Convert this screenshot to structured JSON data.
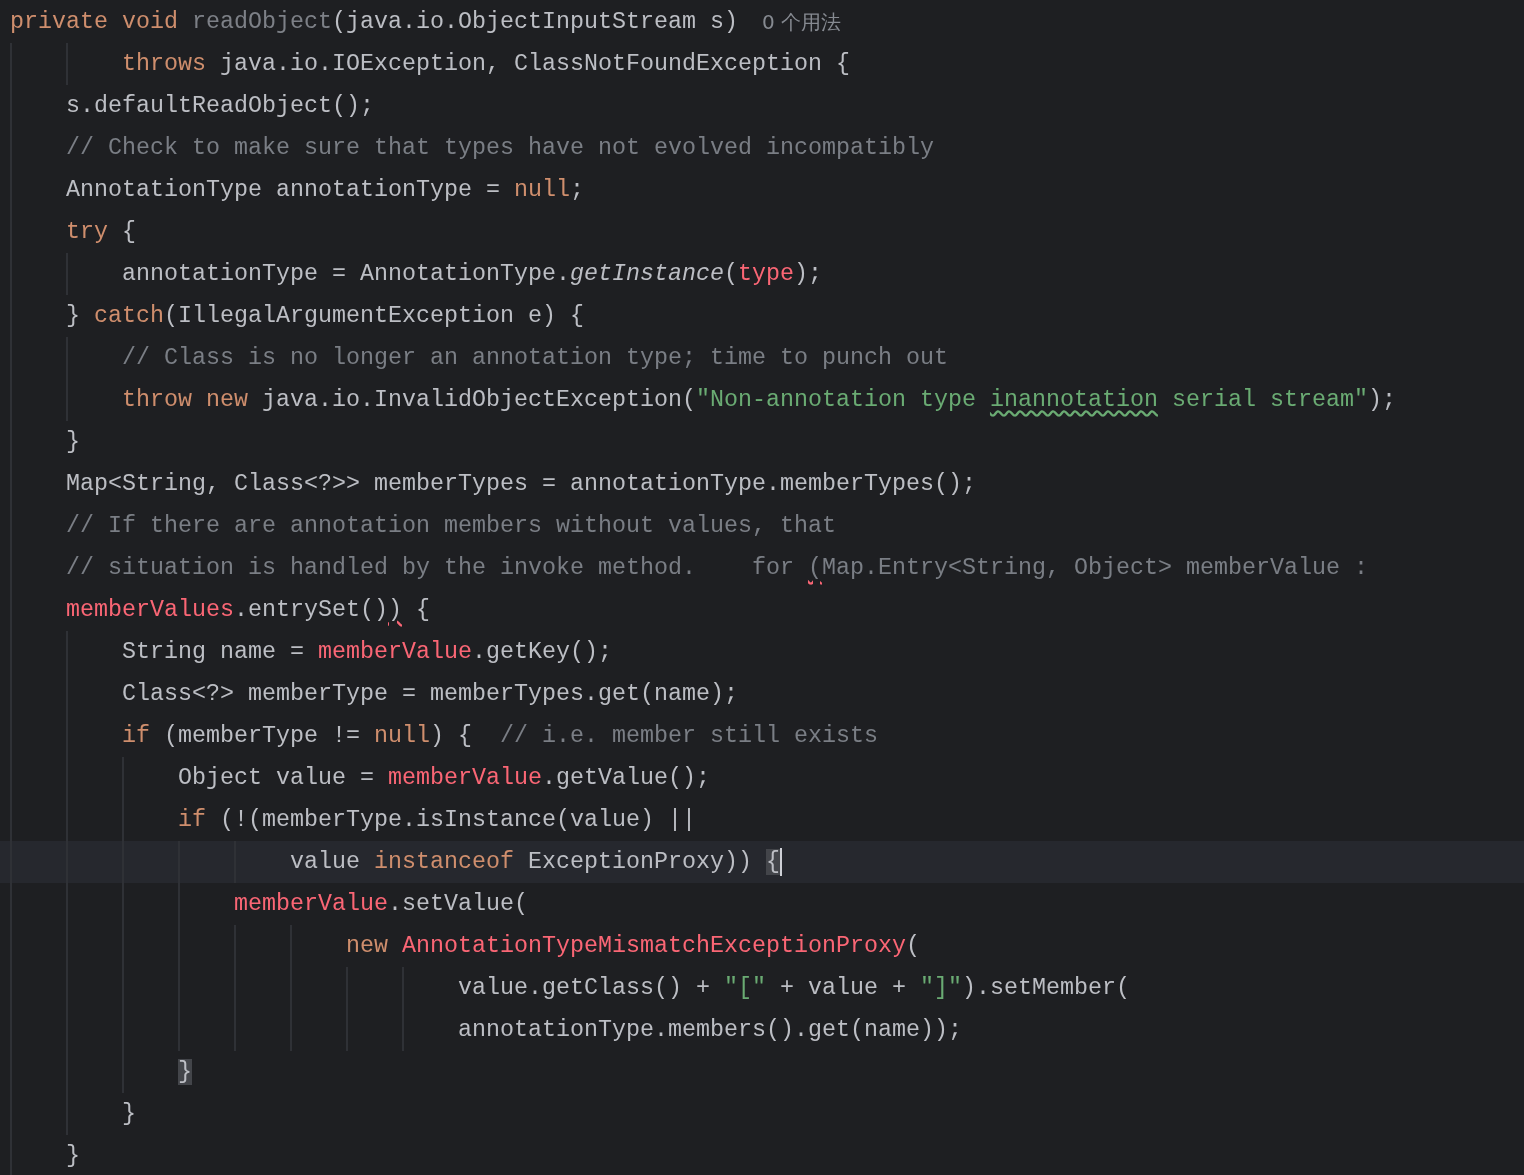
{
  "editor": {
    "lines": [
      {
        "current": false,
        "hint": "0 个用法",
        "tokens": [
          {
            "kind": "keyword",
            "text": "private void "
          },
          {
            "kind": "unused",
            "text": "readObject"
          },
          {
            "kind": "plain",
            "text": "(java.io.ObjectInputStream s)"
          }
        ]
      },
      {
        "current": false,
        "tokens": [
          {
            "kind": "keyword",
            "text": "        throws"
          },
          {
            "kind": "plain",
            "text": " java.io.IOException, ClassNotFoundException {"
          }
        ]
      },
      {
        "current": false,
        "tokens": [
          {
            "kind": "plain",
            "text": "    s.defaultReadObject();"
          }
        ]
      },
      {
        "current": false,
        "tokens": [
          {
            "kind": "comment",
            "text": "    // Check to make sure that types have not evolved incompatibly"
          }
        ]
      },
      {
        "current": false,
        "tokens": [
          {
            "kind": "plain",
            "text": "    AnnotationType annotationType = "
          },
          {
            "kind": "keyword",
            "text": "null"
          },
          {
            "kind": "plain",
            "text": ";"
          }
        ]
      },
      {
        "current": false,
        "tokens": [
          {
            "kind": "keyword",
            "text": "    try"
          },
          {
            "kind": "plain",
            "text": " {"
          }
        ]
      },
      {
        "current": false,
        "tokens": [
          {
            "kind": "plain",
            "text": "        annotationType = AnnotationType."
          },
          {
            "kind": "italic",
            "text": "getInstance"
          },
          {
            "kind": "plain",
            "text": "("
          },
          {
            "kind": "error",
            "text": "type"
          },
          {
            "kind": "plain",
            "text": ");"
          }
        ]
      },
      {
        "current": false,
        "tokens": [
          {
            "kind": "plain",
            "text": "    } "
          },
          {
            "kind": "keyword",
            "text": "catch"
          },
          {
            "kind": "plain",
            "text": "(IllegalArgumentException e) {"
          }
        ]
      },
      {
        "current": false,
        "tokens": [
          {
            "kind": "comment",
            "text": "        // Class is no longer an annotation type; time to punch out"
          }
        ]
      },
      {
        "current": false,
        "tokens": [
          {
            "kind": "keyword",
            "text": "        throw new"
          },
          {
            "kind": "plain",
            "text": " java.io.InvalidObjectException("
          },
          {
            "kind": "string",
            "text": "\"Non-annotation type "
          },
          {
            "kind": "string",
            "text": "inannotation",
            "typo": true
          },
          {
            "kind": "string",
            "text": " serial stream\""
          },
          {
            "kind": "plain",
            "text": ");"
          }
        ]
      },
      {
        "current": false,
        "tokens": [
          {
            "kind": "plain",
            "text": "    }"
          }
        ]
      },
      {
        "current": false,
        "tokens": [
          {
            "kind": "plain",
            "text": "    Map<String, Class<?>> memberTypes = annotationType.memberTypes();"
          }
        ]
      },
      {
        "current": false,
        "tokens": [
          {
            "kind": "comment",
            "text": "    // If there are annotation members without values, that"
          }
        ]
      },
      {
        "current": false,
        "tokens": [
          {
            "kind": "comment",
            "text": "    // situation is handled by the invoke method.    for "
          },
          {
            "kind": "comment",
            "text": "(",
            "flagged": true
          },
          {
            "kind": "comment",
            "text": "Map.Entry<String, Object> memberValue :"
          }
        ]
      },
      {
        "current": false,
        "tokens": [
          {
            "kind": "error",
            "text": "    memberValues"
          },
          {
            "kind": "plain",
            "text": ".entrySet()"
          },
          {
            "kind": "plain",
            "text": ")",
            "flagged": true
          },
          {
            "kind": "plain",
            "text": " {"
          }
        ]
      },
      {
        "current": false,
        "tokens": [
          {
            "kind": "plain",
            "text": "        String name = "
          },
          {
            "kind": "error",
            "text": "memberValue"
          },
          {
            "kind": "plain",
            "text": ".getKey();"
          }
        ]
      },
      {
        "current": false,
        "tokens": [
          {
            "kind": "plain",
            "text": "        Class<?> memberType = memberTypes.get(name);"
          }
        ]
      },
      {
        "current": false,
        "tokens": [
          {
            "kind": "keyword",
            "text": "        if"
          },
          {
            "kind": "plain",
            "text": " (memberType != "
          },
          {
            "kind": "keyword",
            "text": "null"
          },
          {
            "kind": "plain",
            "text": ") {  "
          },
          {
            "kind": "comment",
            "text": "// i.e. member still exists"
          }
        ]
      },
      {
        "current": false,
        "tokens": [
          {
            "kind": "plain",
            "text": "            Object value = "
          },
          {
            "kind": "error",
            "text": "memberValue"
          },
          {
            "kind": "plain",
            "text": ".getValue();"
          }
        ]
      },
      {
        "current": false,
        "tokens": [
          {
            "kind": "keyword",
            "text": "            if"
          },
          {
            "kind": "plain",
            "text": " (!(memberType.isInstance(value) ||"
          }
        ]
      },
      {
        "current": true,
        "tokens": [
          {
            "kind": "plain",
            "text": "                    value "
          },
          {
            "kind": "keyword",
            "text": "instanceof"
          },
          {
            "kind": "plain",
            "text": " ExceptionProxy)) "
          },
          {
            "kind": "plain",
            "text": "{",
            "matched": true
          }
        ]
      },
      {
        "current": false,
        "tokens": [
          {
            "kind": "error",
            "text": "                memberValue"
          },
          {
            "kind": "plain",
            "text": ".setValue("
          }
        ]
      },
      {
        "current": false,
        "tokens": [
          {
            "kind": "keyword",
            "text": "                        new "
          },
          {
            "kind": "error",
            "text": "AnnotationTypeMismatchExceptionProxy"
          },
          {
            "kind": "plain",
            "text": "("
          }
        ]
      },
      {
        "current": false,
        "tokens": [
          {
            "kind": "plain",
            "text": "                                value.getClass() + "
          },
          {
            "kind": "string",
            "text": "\"[\""
          },
          {
            "kind": "plain",
            "text": " + value + "
          },
          {
            "kind": "string",
            "text": "\"]\""
          },
          {
            "kind": "plain",
            "text": ").setMember("
          }
        ]
      },
      {
        "current": false,
        "tokens": [
          {
            "kind": "plain",
            "text": "                                annotationType.members().get(name));"
          }
        ]
      },
      {
        "current": false,
        "tokens": [
          {
            "kind": "plain",
            "text": "            }",
            "matched": true
          }
        ]
      },
      {
        "current": false,
        "tokens": [
          {
            "kind": "plain",
            "text": "        }"
          }
        ]
      },
      {
        "current": false,
        "tokens": [
          {
            "kind": "plain",
            "text": "    }"
          }
        ]
      }
    ]
  }
}
